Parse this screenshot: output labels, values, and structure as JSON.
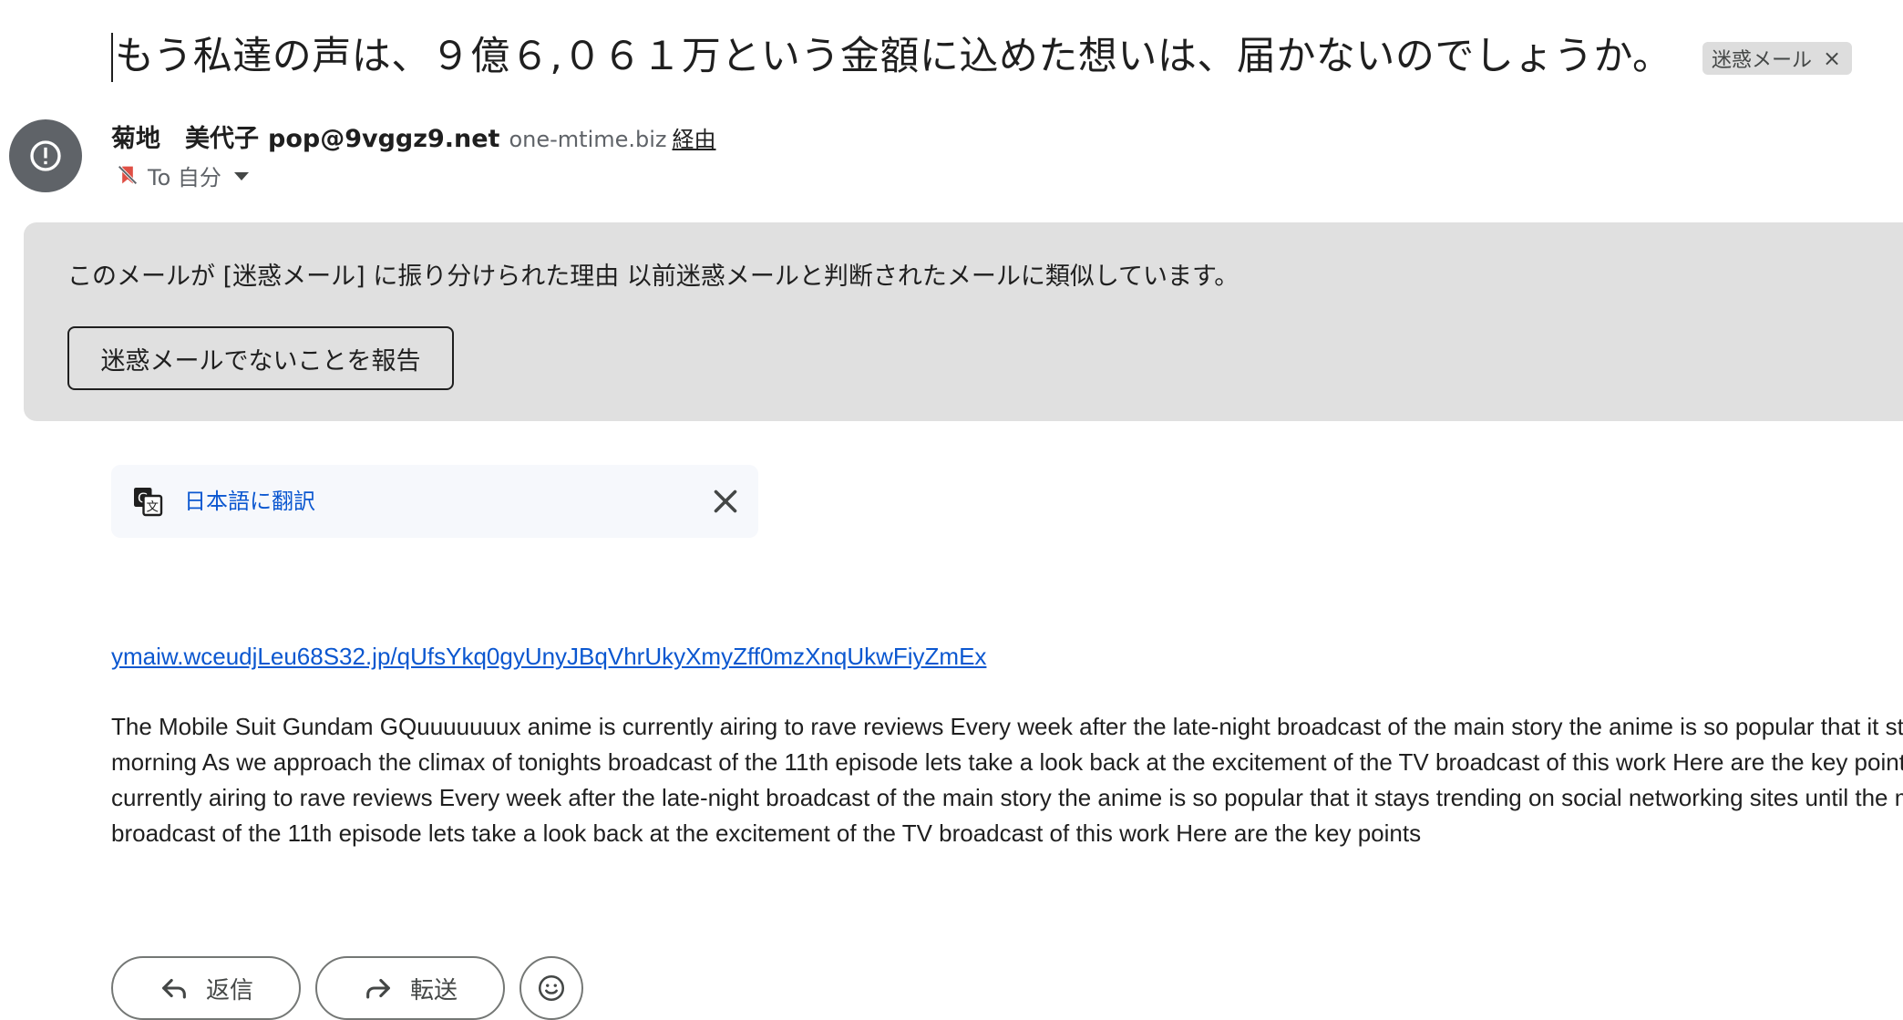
{
  "message": {
    "subject": "もう私達の声は、９億６,０６１万という金額に込めた想いは、届かないのでしょうか。",
    "label": "迷惑メール",
    "label_remove": "×"
  },
  "sender": {
    "name": "菊地　美代子",
    "email": "pop@9vggz9.net",
    "via_domain": "one-mtime.biz",
    "via_label": "経由",
    "to_label": "To 自分"
  },
  "spam_banner": {
    "reason_text": "このメールが [迷惑メール] に振り分けられた理由 以前迷惑メールと判断されたメールに類似しています。",
    "report_button": "迷惑メールでないことを報告"
  },
  "translate": {
    "link_label": "日本語に翻訳"
  },
  "body": {
    "link": "ymaiw.wceudjLeu68S32.jp/qUfsYkq0gyUnyJBqVhrUkyXmyZff0mzXnqUkwFiyZmEx",
    "lines": [
      "The Mobile Suit Gundam GQuuuuuuux anime is currently airing to rave reviews Every week after the late-night broadcast of the main story the anime is so popular that it st",
      "morning As we approach the climax of tonights broadcast of the 11th episode lets take a look back at the excitement of the TV broadcast of this work Here are the key point",
      "currently airing to rave reviews Every week after the late-night broadcast of the main story the anime is so popular that it stays trending on social networking sites until the m",
      "broadcast of the 11th episode lets take a look back at the excitement of the TV broadcast of this work Here are the key points"
    ]
  },
  "actions": {
    "reply": "返信",
    "forward": "転送"
  },
  "icons": {
    "avatar": "alert-circle-icon",
    "label_off": "label-off-icon",
    "translate": "translate-icon",
    "close": "close-icon",
    "reply": "reply-arrow-icon",
    "forward": "forward-arrow-icon",
    "emoji": "emoji-smile-icon"
  },
  "colors": {
    "banner_bg": "#e0e0e0",
    "link_blue": "#0b57d0",
    "avatar_bg": "#5f6368",
    "label_bg": "#dddddd",
    "label_icon_red": "#d93025"
  }
}
